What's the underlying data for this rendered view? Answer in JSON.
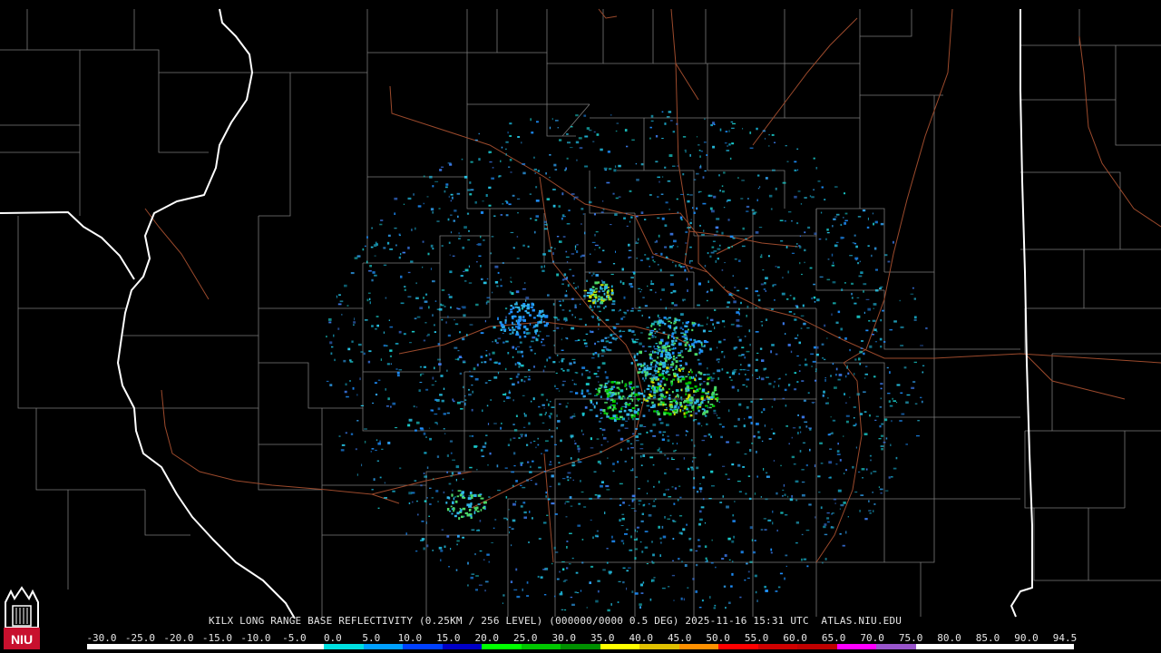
{
  "map": {
    "caption": "KILX LONG RANGE BASE REFLECTIVITY (0.25KM / 256 LEVEL) (000000/0000 0.5 DEG) 2025-11-16 15:31 UTC  ATLAS.NIU.EDU",
    "logo_text": "NIU",
    "colors": {
      "background": "#000000",
      "county_lines": "#7a7a7a",
      "state_lines": "#ffffff",
      "highways": "#9c4a2c",
      "text": "#e6e6e6",
      "logo_red": "#c8102e"
    },
    "scale_labels": [
      "-30.0",
      "-25.0",
      "-20.0",
      "-15.0",
      "-10.0",
      "-5.0",
      "0.0",
      "5.0",
      "10.0",
      "15.0",
      "20.0",
      "25.0",
      "30.0",
      "35.0",
      "40.0",
      "45.0",
      "50.0",
      "55.0",
      "60.0",
      "65.0",
      "70.0",
      "75.0",
      "80.0",
      "85.0",
      "90.0",
      "94.5"
    ],
    "colorbar_colors": [
      "#ffffff",
      "#ffffff",
      "#ffffff",
      "#ffffff",
      "#ffffff",
      "#ffffff",
      "#00e0e0",
      "#00a0ff",
      "#0040ff",
      "#0000c8",
      "#00ff00",
      "#00c800",
      "#009000",
      "#ffff00",
      "#e0c000",
      "#ff9000",
      "#ff0000",
      "#d00000",
      "#c00000",
      "#ff00ff",
      "#9955cc",
      "#ffffff",
      "#ffffff",
      "#ffffff",
      "#ffffff"
    ]
  }
}
